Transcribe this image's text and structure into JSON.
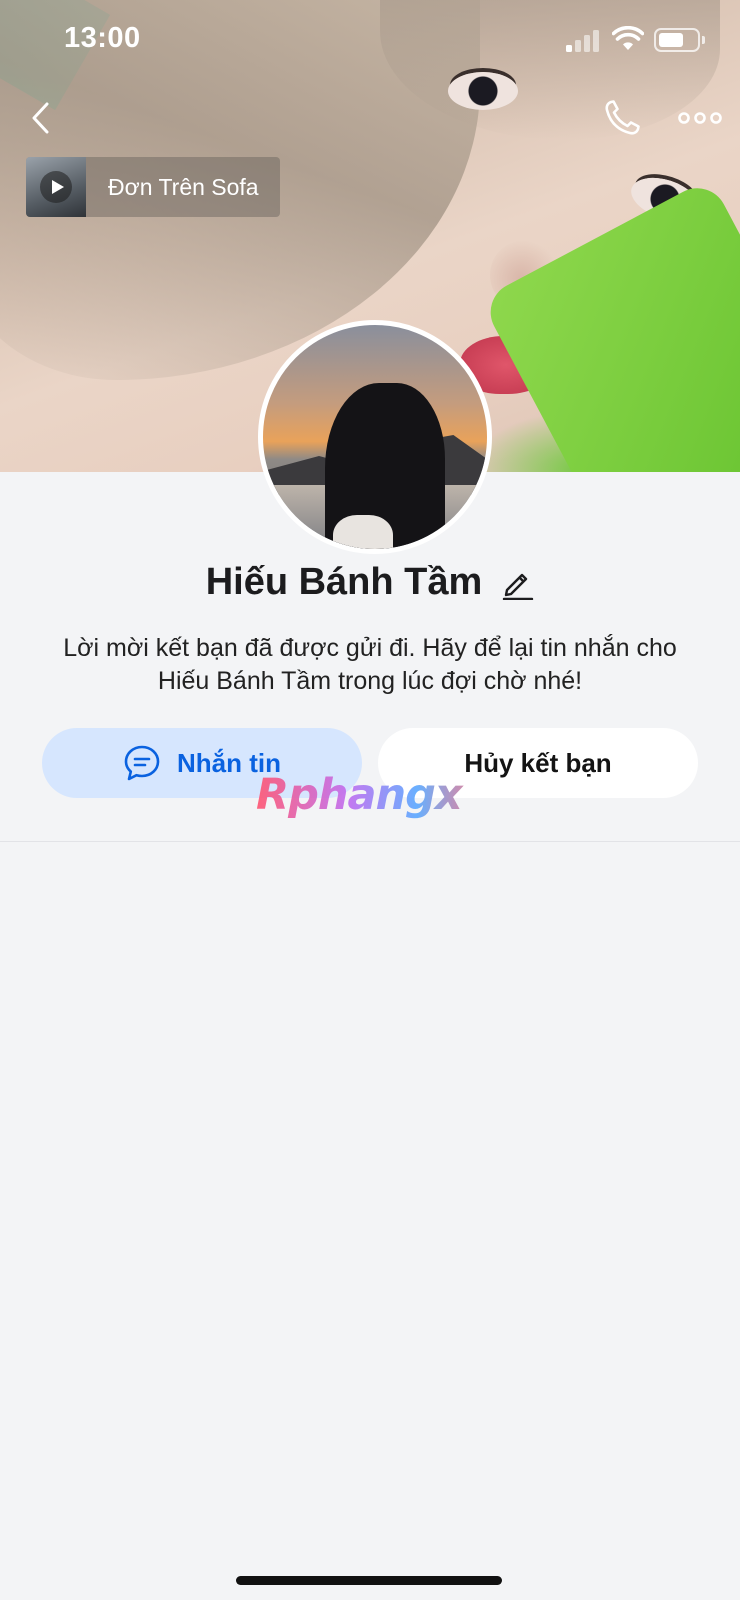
{
  "status_bar": {
    "time": "13:00",
    "signal_bars_active": 1,
    "signal_bars_total": 4,
    "battery_level": 0.65
  },
  "nav": {
    "back_icon": "chevron-left-icon",
    "call_icon": "phone-icon",
    "more_icon": "more-dots-icon"
  },
  "music": {
    "title": "Đơn Trên Sofa",
    "play_icon": "play-icon"
  },
  "profile": {
    "name": "Hiếu Bánh Tầm",
    "edit_icon": "pencil-icon",
    "friend_request_note": "Lời mời kết bạn đã được gửi đi. Hãy để lại tin nhắn cho Hiếu Bánh Tầm trong lúc đợi chờ nhé!"
  },
  "actions": {
    "message_label": "Nhắn tin",
    "message_icon": "chat-bubble-icon",
    "unfriend_label": "Hủy kết bạn"
  },
  "watermark": {
    "text": "Rphangx"
  },
  "colors": {
    "accent": "#0a62e0",
    "message_button_bg": "#d6e6fe",
    "page_bg": "#f3f4f6"
  }
}
